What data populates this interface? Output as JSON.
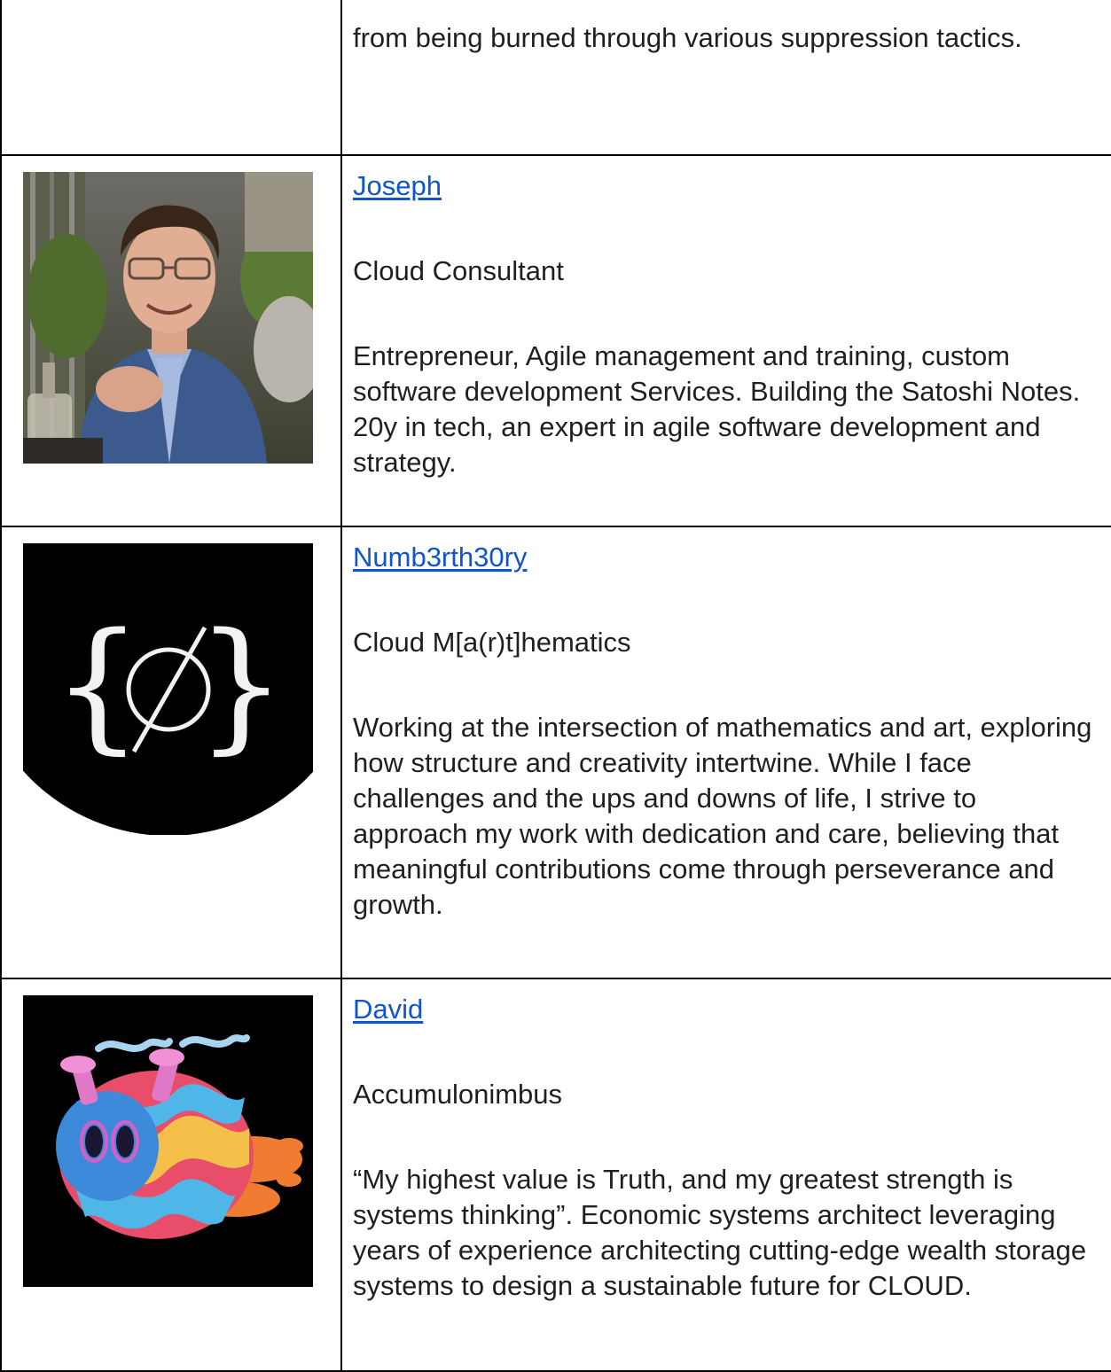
{
  "rows": [
    {
      "text_continued": "from being burned through various suppression tactics."
    },
    {
      "name": "Joseph",
      "role": "Cloud Consultant",
      "bio": "Entrepreneur, Agile management and training, custom software development Services. Building the Satoshi Notes. 20y in tech, an expert in agile software development and strategy.",
      "avatar_icon": "person-photo"
    },
    {
      "name": "Numb3rth30ry",
      "role": "Cloud M[a(r)t]hematics",
      "bio": "Working at the intersection of mathematics and art, exploring how structure and creativity intertwine. While I face challenges and the ups and downs of life, I strive to approach my work with dedication and care, believing that meaningful contributions come through perseverance and growth.",
      "avatar_icon": "empty-set-logo",
      "avatar_glyph": "{ ∅ }"
    },
    {
      "name": "David",
      "role": "Accumulonimbus",
      "bio": "“My highest value is Truth, and my greatest strength is systems thinking”. Economic systems architect leveraging years of experience architecting cutting-edge wealth storage systems to design a sustainable future for CLOUD.",
      "avatar_icon": "psychedelic-creature-art"
    }
  ],
  "colors": {
    "link": "#1155cc",
    "border": "#000000",
    "text": "#1f1f1f"
  }
}
